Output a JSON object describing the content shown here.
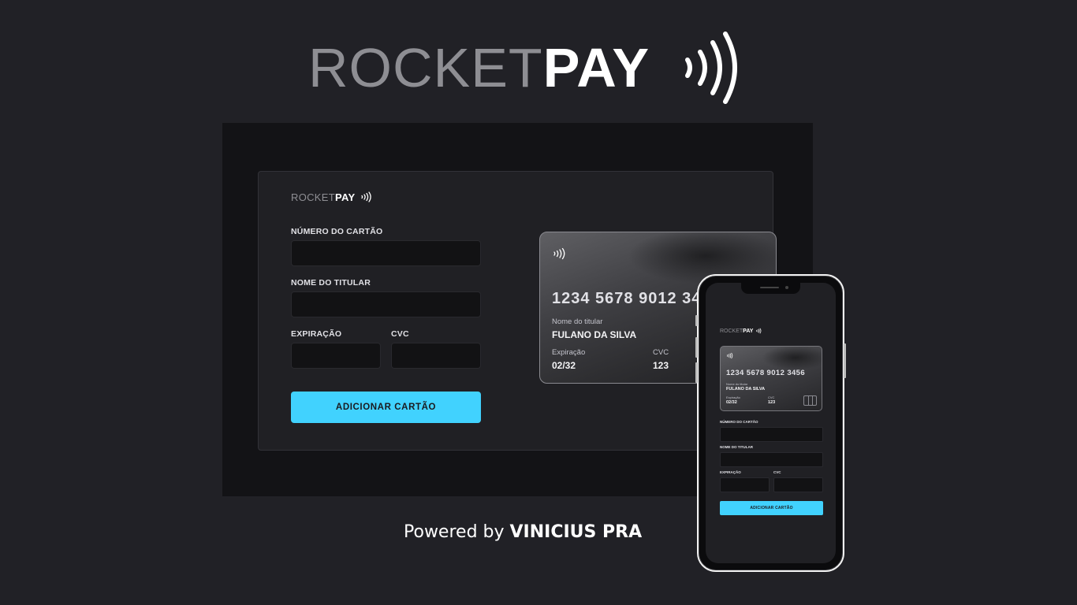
{
  "brand": {
    "left": "ROCKET",
    "right": "PAY"
  },
  "form": {
    "card_number_label": "NÚMERO DO CARTÃO",
    "card_holder_label": "NOME DO TITULAR",
    "expiration_label": "EXPIRAÇÃO",
    "cvc_label": "CVC",
    "submit_label": "ADICIONAR CARTÃO",
    "card_number_value": "",
    "card_holder_value": "",
    "expiration_value": "",
    "cvc_value": ""
  },
  "card": {
    "number": "1234 5678 9012 3456",
    "holder_label": "Nome do titular",
    "holder_value": "FULANO DA SILVA",
    "expiration_label": "Expiração",
    "expiration_value": "02/32",
    "cvc_label": "CVC",
    "cvc_value": "123"
  },
  "footer": {
    "prefix": "Powered by",
    "author": "VINICIUS PRA"
  },
  "colors": {
    "background": "#212126",
    "frame": "#131316",
    "panel": "#202024",
    "input": "#121214",
    "accent": "#41d2fe"
  },
  "icons": {
    "contactless": "contactless-waves-icon",
    "chip": "card-chip-icon"
  }
}
